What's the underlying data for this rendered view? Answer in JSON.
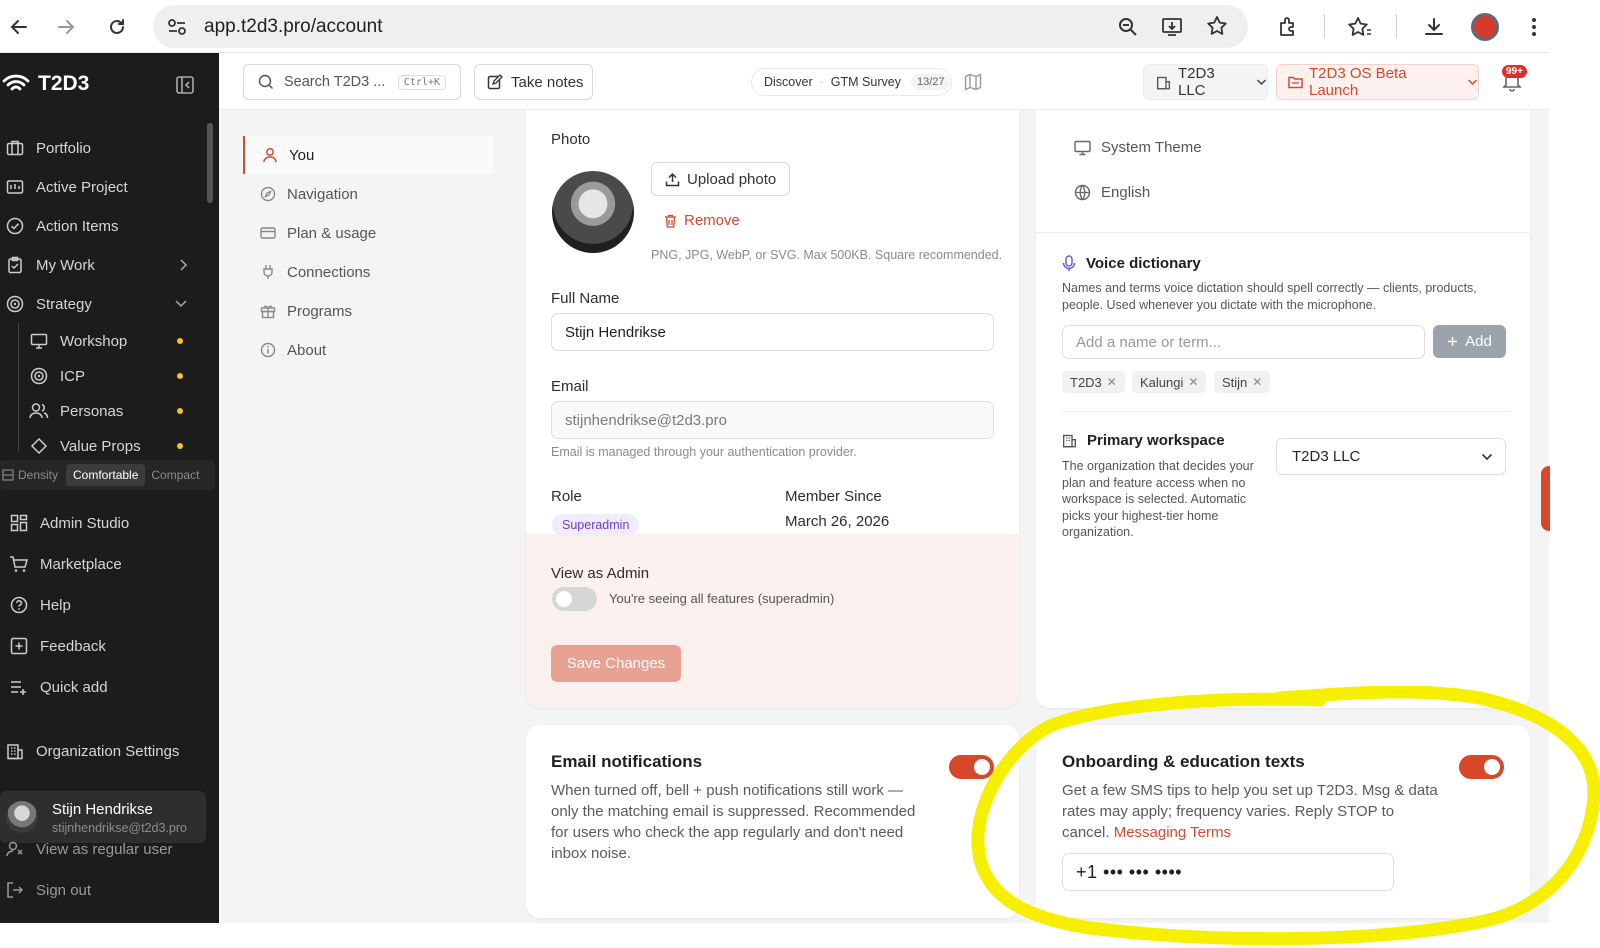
{
  "browser": {
    "url": "app.t2d3.pro/account",
    "notification_badge": "99+"
  },
  "sidebar": {
    "brand": "T2D3",
    "items": [
      {
        "label": "Portfolio"
      },
      {
        "label": "Active Project"
      },
      {
        "label": "Action Items"
      },
      {
        "label": "My Work"
      },
      {
        "label": "Strategy"
      }
    ],
    "strategy_children": [
      {
        "label": "Workshop"
      },
      {
        "label": "ICP"
      },
      {
        "label": "Personas"
      },
      {
        "label": "Value Props"
      }
    ],
    "density": {
      "label": "Density",
      "options": [
        "Comfortable",
        "Compact"
      ],
      "selected": "Comfortable"
    },
    "bottom_items": [
      {
        "label": "Admin Studio"
      },
      {
        "label": "Marketplace"
      },
      {
        "label": "Help"
      },
      {
        "label": "Feedback"
      },
      {
        "label": "Quick add"
      }
    ],
    "org_settings": "Organization Settings",
    "user": {
      "name": "Stijn Hendrikse",
      "email": "stijnhendrikse@t2d3.pro"
    },
    "view_as": "View as regular user",
    "sign_out": "Sign out"
  },
  "topbar": {
    "search_placeholder": "Search T2D3 ...",
    "search_shortcut": "Ctrl+K",
    "take_notes": "Take notes",
    "discover": "Discover",
    "survey": "GTM Survey",
    "survey_progress": "13/27",
    "workspace": "T2D3 LLC",
    "launch": "T2D3 OS Beta Launch"
  },
  "settings_nav": [
    {
      "label": "You"
    },
    {
      "label": "Navigation"
    },
    {
      "label": "Plan & usage"
    },
    {
      "label": "Connections"
    },
    {
      "label": "Programs"
    },
    {
      "label": "About"
    }
  ],
  "profile": {
    "photo_label": "Photo",
    "upload": "Upload photo",
    "remove": "Remove",
    "photo_hint": "PNG, JPG, WebP, or SVG. Max 500KB. Square recommended.",
    "full_name_label": "Full Name",
    "full_name": "Stijn Hendrikse",
    "email_label": "Email",
    "email": "stijnhendrikse@t2d3.pro",
    "email_hint": "Email is managed through your authentication provider.",
    "role_label": "Role",
    "role": "Superadmin",
    "member_since_label": "Member Since",
    "member_since": "March 26, 2026",
    "view_admin_label": "View as Admin",
    "view_admin_hint": "You're seeing all features (superadmin)",
    "save": "Save Changes"
  },
  "prefs": {
    "theme": "System Theme",
    "language": "English",
    "voice_title": "Voice dictionary",
    "voice_desc": "Names and terms voice dictation should spell correctly — clients, products, people. Used whenever you dictate with the microphone.",
    "voice_placeholder": "Add a name or term...",
    "add": "Add",
    "terms": [
      "T2D3",
      "Kalungi",
      "Stijn"
    ],
    "workspace_title": "Primary workspace",
    "workspace_desc": "The organization that decides your plan and feature access when no workspace is selected. Automatic picks your highest-tier home organization.",
    "workspace_value": "T2D3 LLC"
  },
  "email_notifications": {
    "title": "Email notifications",
    "desc": "When turned off, bell + push notifications still work — only the matching email is suppressed. Recommended for users who check the app regularly and don't need inbox noise.",
    "enabled": true
  },
  "onboarding": {
    "title": "Onboarding & education texts",
    "desc": "Get a few SMS tips to help you set up T2D3. Msg & data rates may apply; frequency varies. Reply STOP to cancel.",
    "terms_link": "Messaging Terms",
    "phone": "+1 ••• ••• ••••",
    "enabled": true
  },
  "colors": {
    "accent": "#d9472b",
    "highlight": "#f6f000",
    "sidebar_bg": "#1c1c1c"
  }
}
